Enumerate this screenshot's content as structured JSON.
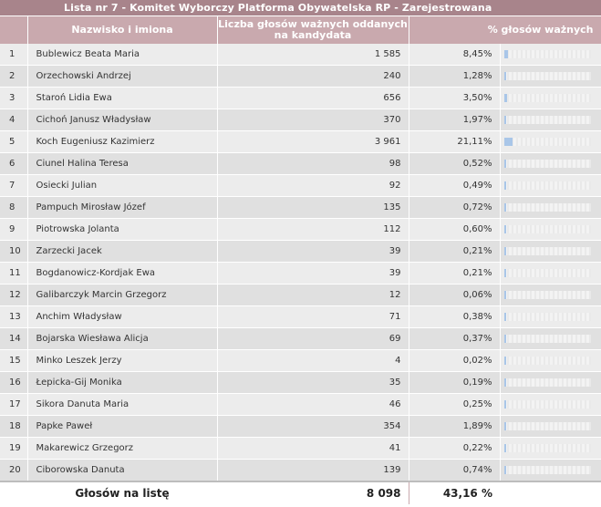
{
  "table": {
    "title": "Lista nr 7 - Komitet Wyborczy Platforma Obywatelska RP - Zarejestrowana",
    "headers": {
      "num": "",
      "name": "Nazwisko i imiona",
      "votes": "Liczba głosów ważnych oddanych na kandydata",
      "pct": "% głosów ważnych"
    },
    "rows": [
      {
        "num": "1",
        "name": "Bublewicz Beata Maria",
        "votes": "1 585",
        "pct": "8,45%",
        "bar": 0.0845
      },
      {
        "num": "2",
        "name": "Orzechowski Andrzej",
        "votes": "240",
        "pct": "1,28%",
        "bar": 0.0128
      },
      {
        "num": "3",
        "name": "Staroń Lidia Ewa",
        "votes": "656",
        "pct": "3,50%",
        "bar": 0.035
      },
      {
        "num": "4",
        "name": "Cichoń Janusz Władysław",
        "votes": "370",
        "pct": "1,97%",
        "bar": 0.0197
      },
      {
        "num": "5",
        "name": "Koch Eugeniusz Kazimierz",
        "votes": "3 961",
        "pct": "21,11%",
        "bar": 0.2111
      },
      {
        "num": "6",
        "name": "Ciunel Halina Teresa",
        "votes": "98",
        "pct": "0,52%",
        "bar": 0.0052
      },
      {
        "num": "7",
        "name": "Osiecki Julian",
        "votes": "92",
        "pct": "0,49%",
        "bar": 0.0049
      },
      {
        "num": "8",
        "name": "Pampuch Mirosław Józef",
        "votes": "135",
        "pct": "0,72%",
        "bar": 0.0072
      },
      {
        "num": "9",
        "name": "Piotrowska Jolanta",
        "votes": "112",
        "pct": "0,60%",
        "bar": 0.006
      },
      {
        "num": "10",
        "name": "Zarzecki Jacek",
        "votes": "39",
        "pct": "0,21%",
        "bar": 0.0021
      },
      {
        "num": "11",
        "name": "Bogdanowicz-Kordjak Ewa",
        "votes": "39",
        "pct": "0,21%",
        "bar": 0.0021
      },
      {
        "num": "12",
        "name": "Galibarczyk Marcin Grzegorz",
        "votes": "12",
        "pct": "0,06%",
        "bar": 0.0006
      },
      {
        "num": "13",
        "name": "Anchim Władysław",
        "votes": "71",
        "pct": "0,38%",
        "bar": 0.0038
      },
      {
        "num": "14",
        "name": "Bojarska Wiesława Alicja",
        "votes": "69",
        "pct": "0,37%",
        "bar": 0.0037
      },
      {
        "num": "15",
        "name": "Minko Leszek Jerzy",
        "votes": "4",
        "pct": "0,02%",
        "bar": 0.0002
      },
      {
        "num": "16",
        "name": "Łepicka-Gij Monika",
        "votes": "35",
        "pct": "0,19%",
        "bar": 0.0019
      },
      {
        "num": "17",
        "name": "Sikora Danuta Maria",
        "votes": "46",
        "pct": "0,25%",
        "bar": 0.0025
      },
      {
        "num": "18",
        "name": "Papke Paweł",
        "votes": "354",
        "pct": "1,89%",
        "bar": 0.0189
      },
      {
        "num": "19",
        "name": "Makarewicz Grzegorz",
        "votes": "41",
        "pct": "0,22%",
        "bar": 0.0022
      },
      {
        "num": "20",
        "name": "Ciborowska Danuta",
        "votes": "139",
        "pct": "0,74%",
        "bar": 0.0074
      }
    ],
    "summary": {
      "label": "Głosów na listę",
      "votes": "8 098",
      "pct": "43,16 %"
    }
  },
  "colors": {
    "title_bg": "#a8848b",
    "header_bg": "#c9a9ae",
    "bar_fill": "#a9c6e8"
  }
}
